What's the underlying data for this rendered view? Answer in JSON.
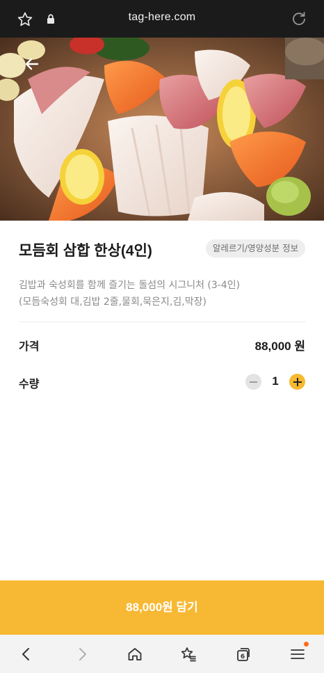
{
  "browser": {
    "url": "tag-here.com",
    "icons": [
      "star-icon",
      "lock-icon",
      "reload-icon"
    ]
  },
  "hero": {
    "back_icon": "back-arrow-icon"
  },
  "product": {
    "title": "모듬회 삼합 한상(4인)",
    "allergy_label": "알레르기/영양성분 정보",
    "description_line1": "김밥과 숙성회를 함께 즐기는 돌섬의 시그니처 (3-4인)",
    "description_line2": "(모듬숙성회 대,김밥 2줄,물회,묵은지,김,막장)"
  },
  "price": {
    "label": "가격",
    "value": "88,000 원"
  },
  "quantity": {
    "label": "수량",
    "value": "1"
  },
  "cta": {
    "label": "88,000원 담기"
  },
  "bottom_nav": {
    "items": [
      "back-icon",
      "forward-icon",
      "home-icon",
      "bookmarks-icon",
      "tabs-icon",
      "menu-icon"
    ],
    "tabs_count": "6"
  },
  "colors": {
    "accent": "#f7b833",
    "plus_button": "#f6b92f",
    "notification_dot": "#ff6a1a",
    "topbar": "#1b1b1b"
  }
}
